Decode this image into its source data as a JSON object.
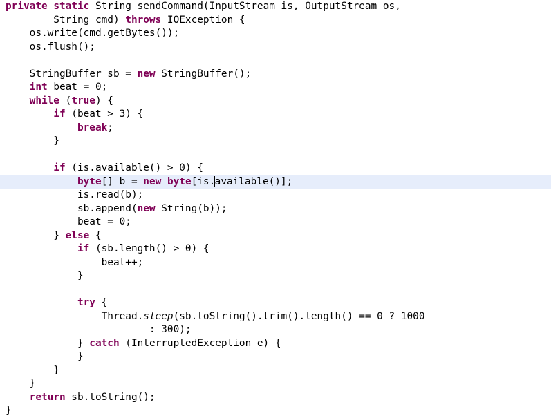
{
  "editor": {
    "language": "Java",
    "font_size_px": 14,
    "colors": {
      "background": "#ffffff",
      "foreground": "#000000",
      "keyword": "#7f0055",
      "current_line_highlight": "#e6edfb",
      "caret": "#000000"
    },
    "caret": {
      "line_index": 13,
      "after_text": "                byte[] b = new byte[is."
    },
    "current_line_index": 13,
    "lines": [
      {
        "index": 0,
        "indent": "",
        "current": false,
        "tokens": [
          {
            "type": "kw",
            "text": "private"
          },
          {
            "type": "plain",
            "text": " "
          },
          {
            "type": "kw",
            "text": "static"
          },
          {
            "type": "plain",
            "text": " String sendCommand(InputStream is, OutputStream os,"
          }
        ]
      },
      {
        "index": 1,
        "indent": "        ",
        "current": false,
        "tokens": [
          {
            "type": "plain",
            "text": "        String cmd) "
          },
          {
            "type": "kw",
            "text": "throws"
          },
          {
            "type": "plain",
            "text": " IOException {"
          }
        ]
      },
      {
        "index": 2,
        "indent": "    ",
        "current": false,
        "tokens": [
          {
            "type": "plain",
            "text": "    os.write(cmd.getBytes());"
          }
        ]
      },
      {
        "index": 3,
        "indent": "    ",
        "current": false,
        "tokens": [
          {
            "type": "plain",
            "text": "    os.flush();"
          }
        ]
      },
      {
        "index": 4,
        "indent": "",
        "current": false,
        "tokens": [
          {
            "type": "plain",
            "text": ""
          }
        ]
      },
      {
        "index": 5,
        "indent": "    ",
        "current": false,
        "tokens": [
          {
            "type": "plain",
            "text": "    StringBuffer sb = "
          },
          {
            "type": "kw",
            "text": "new"
          },
          {
            "type": "plain",
            "text": " StringBuffer();"
          }
        ]
      },
      {
        "index": 6,
        "indent": "    ",
        "current": false,
        "tokens": [
          {
            "type": "plain",
            "text": "    "
          },
          {
            "type": "kw",
            "text": "int"
          },
          {
            "type": "plain",
            "text": " beat = 0;"
          }
        ]
      },
      {
        "index": 7,
        "indent": "    ",
        "current": false,
        "tokens": [
          {
            "type": "plain",
            "text": "    "
          },
          {
            "type": "kw",
            "text": "while"
          },
          {
            "type": "plain",
            "text": " ("
          },
          {
            "type": "kw",
            "text": "true"
          },
          {
            "type": "plain",
            "text": ") {"
          }
        ]
      },
      {
        "index": 8,
        "indent": "        ",
        "current": false,
        "tokens": [
          {
            "type": "plain",
            "text": "        "
          },
          {
            "type": "kw",
            "text": "if"
          },
          {
            "type": "plain",
            "text": " (beat > 3) {"
          }
        ]
      },
      {
        "index": 9,
        "indent": "            ",
        "current": false,
        "tokens": [
          {
            "type": "plain",
            "text": "            "
          },
          {
            "type": "kw",
            "text": "break"
          },
          {
            "type": "plain",
            "text": ";"
          }
        ]
      },
      {
        "index": 10,
        "indent": "        ",
        "current": false,
        "tokens": [
          {
            "type": "plain",
            "text": "        }"
          }
        ]
      },
      {
        "index": 11,
        "indent": "",
        "current": false,
        "tokens": [
          {
            "type": "plain",
            "text": ""
          }
        ]
      },
      {
        "index": 12,
        "indent": "        ",
        "current": false,
        "tokens": [
          {
            "type": "plain",
            "text": "        "
          },
          {
            "type": "kw",
            "text": "if"
          },
          {
            "type": "plain",
            "text": " (is.available() > 0) {"
          }
        ]
      },
      {
        "index": 13,
        "indent": "            ",
        "current": true,
        "tokens": [
          {
            "type": "plain",
            "text": "            "
          },
          {
            "type": "kw",
            "text": "byte"
          },
          {
            "type": "plain",
            "text": "[] b = "
          },
          {
            "type": "kw",
            "text": "new"
          },
          {
            "type": "plain",
            "text": " "
          },
          {
            "type": "kw",
            "text": "byte"
          },
          {
            "type": "plain",
            "text": "[is."
          },
          {
            "type": "caret",
            "text": ""
          },
          {
            "type": "plain",
            "text": "available()];"
          }
        ]
      },
      {
        "index": 14,
        "indent": "            ",
        "current": false,
        "tokens": [
          {
            "type": "plain",
            "text": "            is.read(b);"
          }
        ]
      },
      {
        "index": 15,
        "indent": "            ",
        "current": false,
        "tokens": [
          {
            "type": "plain",
            "text": "            sb.append("
          },
          {
            "type": "kw",
            "text": "new"
          },
          {
            "type": "plain",
            "text": " String(b));"
          }
        ]
      },
      {
        "index": 16,
        "indent": "            ",
        "current": false,
        "tokens": [
          {
            "type": "plain",
            "text": "            beat = 0;"
          }
        ]
      },
      {
        "index": 17,
        "indent": "        ",
        "current": false,
        "tokens": [
          {
            "type": "plain",
            "text": "        } "
          },
          {
            "type": "kw",
            "text": "else"
          },
          {
            "type": "plain",
            "text": " {"
          }
        ]
      },
      {
        "index": 18,
        "indent": "            ",
        "current": false,
        "tokens": [
          {
            "type": "plain",
            "text": "            "
          },
          {
            "type": "kw",
            "text": "if"
          },
          {
            "type": "plain",
            "text": " (sb.length() > 0) {"
          }
        ]
      },
      {
        "index": 19,
        "indent": "                ",
        "current": false,
        "tokens": [
          {
            "type": "plain",
            "text": "                beat++;"
          }
        ]
      },
      {
        "index": 20,
        "indent": "            ",
        "current": false,
        "tokens": [
          {
            "type": "plain",
            "text": "            }"
          }
        ]
      },
      {
        "index": 21,
        "indent": "",
        "current": false,
        "tokens": [
          {
            "type": "plain",
            "text": ""
          }
        ]
      },
      {
        "index": 22,
        "indent": "            ",
        "current": false,
        "tokens": [
          {
            "type": "plain",
            "text": "            "
          },
          {
            "type": "kw",
            "text": "try"
          },
          {
            "type": "plain",
            "text": " {"
          }
        ]
      },
      {
        "index": 23,
        "indent": "                ",
        "current": false,
        "tokens": [
          {
            "type": "plain",
            "text": "                Thread."
          },
          {
            "type": "static",
            "text": "sleep"
          },
          {
            "type": "plain",
            "text": "(sb.toString().trim().length() == 0 ? 1000"
          }
        ]
      },
      {
        "index": 24,
        "indent": "                        ",
        "current": false,
        "tokens": [
          {
            "type": "plain",
            "text": "                        : 300);"
          }
        ]
      },
      {
        "index": 25,
        "indent": "            ",
        "current": false,
        "tokens": [
          {
            "type": "plain",
            "text": "            } "
          },
          {
            "type": "kw",
            "text": "catch"
          },
          {
            "type": "plain",
            "text": " (InterruptedException e) {"
          }
        ]
      },
      {
        "index": 26,
        "indent": "            ",
        "current": false,
        "tokens": [
          {
            "type": "plain",
            "text": "            }"
          }
        ]
      },
      {
        "index": 27,
        "indent": "        ",
        "current": false,
        "tokens": [
          {
            "type": "plain",
            "text": "        }"
          }
        ]
      },
      {
        "index": 28,
        "indent": "    ",
        "current": false,
        "tokens": [
          {
            "type": "plain",
            "text": "    }"
          }
        ]
      },
      {
        "index": 29,
        "indent": "    ",
        "current": false,
        "tokens": [
          {
            "type": "plain",
            "text": "    "
          },
          {
            "type": "kw",
            "text": "return"
          },
          {
            "type": "plain",
            "text": " sb.toString();"
          }
        ]
      },
      {
        "index": 30,
        "indent": "",
        "current": false,
        "tokens": [
          {
            "type": "plain",
            "text": "}"
          }
        ]
      }
    ]
  }
}
